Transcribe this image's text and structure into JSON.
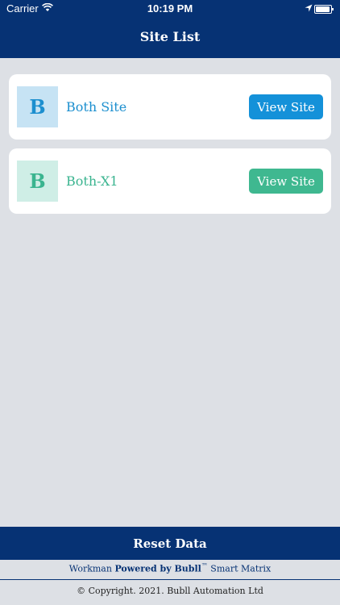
{
  "status_bar": {
    "carrier": "Carrier",
    "time": "10:19 PM"
  },
  "header": {
    "title": "Site List"
  },
  "sites": [
    {
      "initial": "B",
      "name": "Both Site",
      "button": "View Site",
      "accent": "#1491d9",
      "tint": "#c6e3f4"
    },
    {
      "initial": "B",
      "name": "Both-X1",
      "button": "View Site",
      "accent": "#3fb890",
      "tint": "#cfeee6"
    }
  ],
  "footer": {
    "reset_label": "Reset Data",
    "powered_prefix": "Workman ",
    "powered_bold": "Powered by Bubll",
    "powered_tm": "™",
    "powered_suffix": " Smart Matrix",
    "copyright": "© Copyright. 2021.  Bubll Automation Ltd"
  }
}
